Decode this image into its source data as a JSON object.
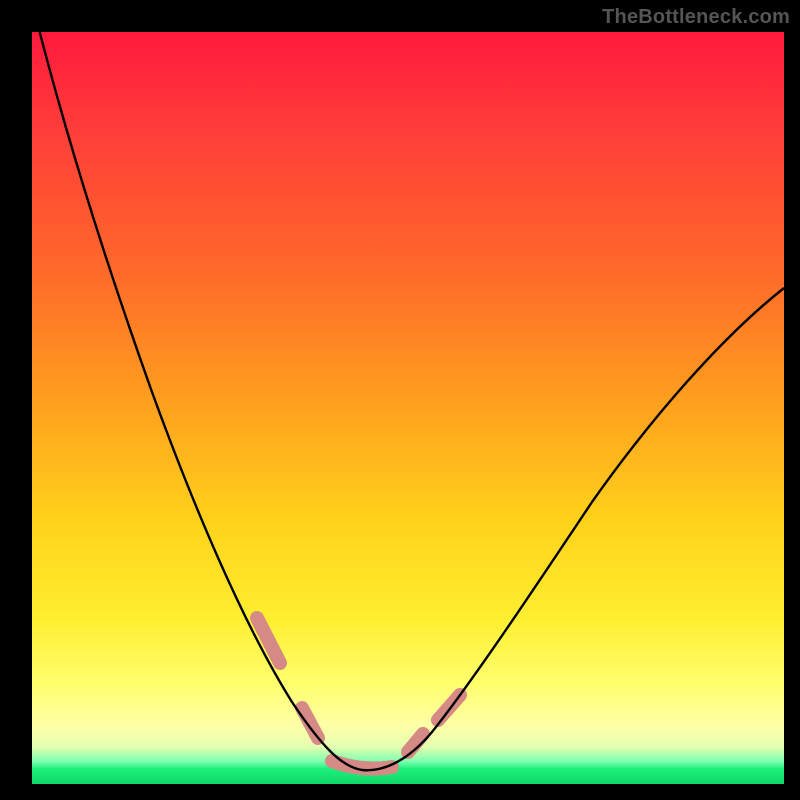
{
  "watermark": "TheBottleneck.com",
  "chart_data": {
    "type": "line",
    "title": "",
    "xlabel": "",
    "ylabel": "",
    "xlim": [
      0,
      100
    ],
    "ylim": [
      0,
      100
    ],
    "background_gradient": {
      "stops": [
        {
          "pos": 0,
          "color": "#ff1a3c"
        },
        {
          "pos": 12,
          "color": "#ff3a3a"
        },
        {
          "pos": 32,
          "color": "#ff6a2a"
        },
        {
          "pos": 50,
          "color": "#ffa21e"
        },
        {
          "pos": 65,
          "color": "#ffd21a"
        },
        {
          "pos": 78,
          "color": "#ffee30"
        },
        {
          "pos": 87,
          "color": "#ffff70"
        },
        {
          "pos": 92,
          "color": "#ffffa6"
        },
        {
          "pos": 95,
          "color": "#e6ffb0"
        },
        {
          "pos": 97,
          "color": "#7dffb0"
        },
        {
          "pos": 98,
          "color": "#1cf07a"
        },
        {
          "pos": 100,
          "color": "#0fd868"
        }
      ]
    },
    "series": [
      {
        "name": "V-curve",
        "color": "#000000",
        "x": [
          0,
          3,
          6,
          10,
          14,
          18,
          22,
          26,
          30,
          33,
          36,
          38,
          40,
          42,
          44,
          48,
          52,
          56,
          60,
          66,
          72,
          78,
          84,
          90,
          96,
          100
        ],
        "y": [
          104,
          92,
          80,
          68,
          57,
          47,
          38,
          30,
          22,
          16,
          10,
          6,
          3,
          2,
          2,
          3,
          6,
          10,
          15,
          22,
          30,
          38,
          46,
          54,
          61,
          66
        ]
      }
    ],
    "highlight_segments": {
      "color": "#d58a85",
      "stroke_width": 12,
      "segments": [
        {
          "x": [
            30,
            33
          ],
          "y": [
            22,
            16
          ]
        },
        {
          "x": [
            36,
            38
          ],
          "y": [
            10,
            6
          ]
        },
        {
          "x": [
            40,
            48
          ],
          "y": [
            3,
            3
          ]
        },
        {
          "x": [
            50,
            52
          ],
          "y": [
            5,
            7
          ]
        },
        {
          "x": [
            54,
            57
          ],
          "y": [
            9,
            12
          ]
        }
      ]
    }
  }
}
